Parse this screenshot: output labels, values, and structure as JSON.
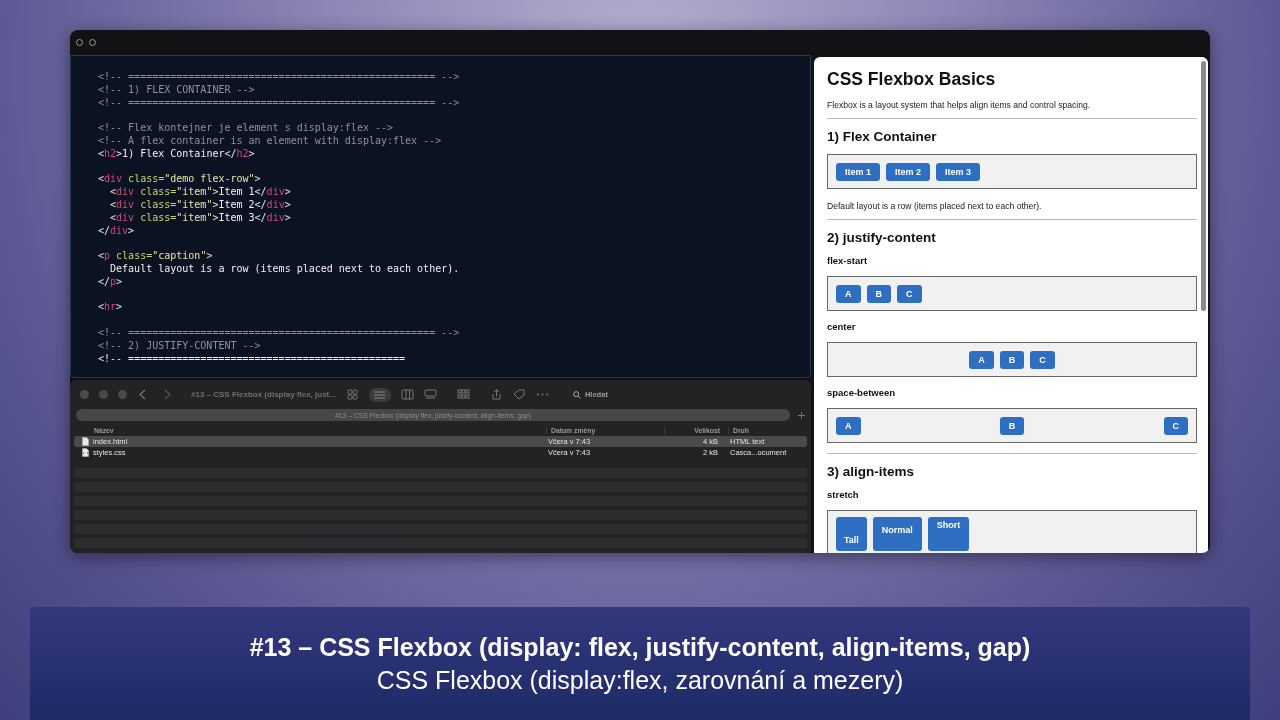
{
  "editor": {
    "lines": [
      {
        "kind": "code",
        "parts": [
          {
            "kind": "comment",
            "text": "<!-- =================================================== -->"
          }
        ]
      },
      {
        "kind": "code",
        "parts": [
          {
            "kind": "comment",
            "text": "<!-- 1) FLEX CONTAINER -->"
          }
        ]
      },
      {
        "kind": "code",
        "parts": [
          {
            "kind": "comment",
            "text": "<!-- =================================================== -->"
          }
        ]
      },
      {
        "kind": "blank"
      },
      {
        "kind": "code",
        "parts": [
          {
            "kind": "comment",
            "text": "<!-- Flex kontejner je element s display:flex -->"
          }
        ]
      },
      {
        "kind": "code",
        "parts": [
          {
            "kind": "comment",
            "text": "<!-- A flex container is an element with display:flex -->"
          }
        ]
      },
      {
        "kind": "code",
        "parts": [
          {
            "kind": "punct",
            "text": "<"
          },
          {
            "kind": "tag",
            "text": "h2"
          },
          {
            "kind": "punct",
            "text": ">"
          },
          {
            "kind": "text",
            "text": "1) Flex Container"
          },
          {
            "kind": "punct",
            "text": "</"
          },
          {
            "kind": "tag",
            "text": "h2"
          },
          {
            "kind": "punct",
            "text": ">"
          }
        ]
      },
      {
        "kind": "blank"
      },
      {
        "kind": "code",
        "parts": [
          {
            "kind": "punct",
            "text": "<"
          },
          {
            "kind": "tag",
            "text": "div"
          },
          {
            "kind": "attr",
            "text": " class="
          },
          {
            "kind": "string",
            "text": "\"demo flex-row\""
          },
          {
            "kind": "punct",
            "text": ">"
          }
        ]
      },
      {
        "kind": "code",
        "parts": [
          {
            "kind": "punct",
            "text": "  <"
          },
          {
            "kind": "tag",
            "text": "div"
          },
          {
            "kind": "attr",
            "text": " class="
          },
          {
            "kind": "string",
            "text": "\"item\""
          },
          {
            "kind": "punct",
            "text": ">"
          },
          {
            "kind": "text",
            "text": "Item 1"
          },
          {
            "kind": "punct",
            "text": "</"
          },
          {
            "kind": "tag",
            "text": "div"
          },
          {
            "kind": "punct",
            "text": ">"
          }
        ]
      },
      {
        "kind": "code",
        "parts": [
          {
            "kind": "punct",
            "text": "  <"
          },
          {
            "kind": "tag",
            "text": "div"
          },
          {
            "kind": "attr",
            "text": " class="
          },
          {
            "kind": "string",
            "text": "\"item\""
          },
          {
            "kind": "punct",
            "text": ">"
          },
          {
            "kind": "text",
            "text": "Item 2"
          },
          {
            "kind": "punct",
            "text": "</"
          },
          {
            "kind": "tag",
            "text": "div"
          },
          {
            "kind": "punct",
            "text": ">"
          }
        ]
      },
      {
        "kind": "code",
        "parts": [
          {
            "kind": "punct",
            "text": "  <"
          },
          {
            "kind": "tag",
            "text": "div"
          },
          {
            "kind": "attr",
            "text": " class="
          },
          {
            "kind": "string",
            "text": "\"item\""
          },
          {
            "kind": "punct",
            "text": ">"
          },
          {
            "kind": "text",
            "text": "Item 3"
          },
          {
            "kind": "punct",
            "text": "</"
          },
          {
            "kind": "tag",
            "text": "div"
          },
          {
            "kind": "punct",
            "text": ">"
          }
        ]
      },
      {
        "kind": "code",
        "parts": [
          {
            "kind": "punct",
            "text": "</"
          },
          {
            "kind": "tag",
            "text": "div"
          },
          {
            "kind": "punct",
            "text": ">"
          }
        ]
      },
      {
        "kind": "blank"
      },
      {
        "kind": "code",
        "parts": [
          {
            "kind": "punct",
            "text": "<"
          },
          {
            "kind": "tag",
            "text": "p"
          },
          {
            "kind": "attr",
            "text": " class="
          },
          {
            "kind": "string",
            "text": "\"caption\""
          },
          {
            "kind": "punct",
            "text": ">"
          }
        ]
      },
      {
        "kind": "code",
        "parts": [
          {
            "kind": "text",
            "text": "  Default layout is a row (items placed next to each other)."
          }
        ]
      },
      {
        "kind": "code",
        "parts": [
          {
            "kind": "punct",
            "text": "</"
          },
          {
            "kind": "tag",
            "text": "p"
          },
          {
            "kind": "punct",
            "text": ">"
          }
        ]
      },
      {
        "kind": "blank"
      },
      {
        "kind": "code",
        "parts": [
          {
            "kind": "punct",
            "text": "<"
          },
          {
            "kind": "tag",
            "text": "hr"
          },
          {
            "kind": "punct",
            "text": ">"
          }
        ]
      },
      {
        "kind": "blank"
      },
      {
        "kind": "code",
        "parts": [
          {
            "kind": "comment",
            "text": "<!-- =================================================== -->"
          }
        ]
      },
      {
        "kind": "code",
        "parts": [
          {
            "kind": "comment",
            "text": "<!-- 2) JUSTIFY-CONTENT -->"
          }
        ]
      },
      {
        "kind": "code",
        "parts": [
          {
            "kind": "punct",
            "text": "<!-- "
          },
          {
            "kind": "text",
            "text": "=============================================="
          }
        ]
      }
    ]
  },
  "finder": {
    "title": "#13 – CSS Flexbox (display flex, just...",
    "search": "Hledat",
    "path": "#13 – CSS Flexbox (display flex, justify-content, align-items, gap)",
    "columns": [
      "Název",
      "Datum změny",
      "Velikost",
      "Druh"
    ],
    "rows": [
      {
        "kind": "html",
        "name": "index.html",
        "date": "Včera v 7:43",
        "size": "4 kB",
        "type": "HTML text",
        "selected": true
      },
      {
        "kind": "css",
        "name": "styles.css",
        "date": "Včera v 7:43",
        "size": "2 kB",
        "type": "Casca...ocument",
        "selected": false
      }
    ]
  },
  "browser": {
    "blocks": [
      {
        "kind": "h1",
        "text": "CSS Flexbox Basics"
      },
      {
        "kind": "p",
        "text": "Flexbox is a layout system that helps align items and control spacing."
      },
      {
        "kind": "hr"
      },
      {
        "kind": "h2",
        "text": "1) Flex Container"
      },
      {
        "kind": "start-demo",
        "items": [
          "Item 1",
          "Item 2",
          "Item 3"
        ]
      },
      {
        "kind": "p",
        "text": "Default layout is a row (items placed next to each other)."
      },
      {
        "kind": "hr"
      },
      {
        "kind": "h2",
        "text": "2) justify-content"
      },
      {
        "kind": "label",
        "text": "flex-start"
      },
      {
        "kind": "start-demo",
        "items": [
          "A",
          "B",
          "C"
        ]
      },
      {
        "kind": "label",
        "text": "center"
      },
      {
        "kind": "center-demo",
        "items": [
          "A",
          "B",
          "C"
        ]
      },
      {
        "kind": "label",
        "text": "space-between"
      },
      {
        "kind": "between-demo",
        "items": [
          "A",
          "B",
          "C"
        ]
      },
      {
        "kind": "hr"
      },
      {
        "kind": "h2",
        "text": "3) align-items"
      },
      {
        "kind": "label",
        "text": "stretch"
      },
      {
        "kind": "stretch-demo",
        "items": [
          "Tall",
          "Normal",
          "Short"
        ]
      }
    ]
  },
  "caption": {
    "title": "#13 – CSS Flexbox (display: flex, justify-content, align-items, gap)",
    "subtitle": "CSS Flexbox (display:flex, zarovnání a mezery)"
  }
}
